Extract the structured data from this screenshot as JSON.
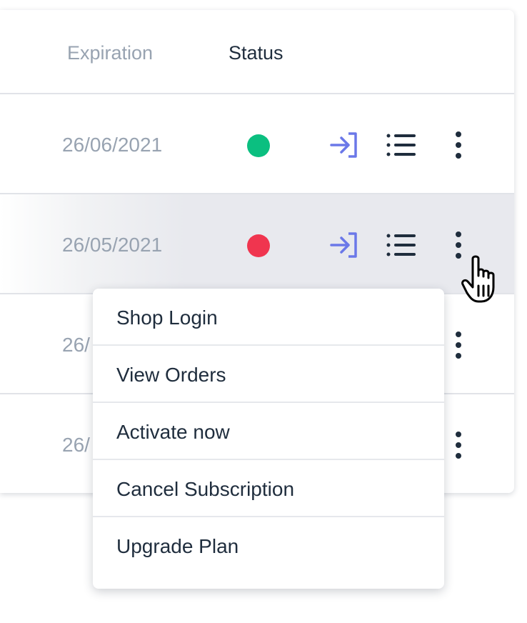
{
  "table": {
    "columns": {
      "expiration": "Expiration",
      "status": "Status"
    },
    "rows": [
      {
        "expiration": "26/06/2021",
        "status": "active",
        "status_color": "#0bbf80"
      },
      {
        "expiration": "26/05/2021",
        "status": "inactive",
        "status_color": "#f0354f",
        "hovered": true
      },
      {
        "expiration": "26/",
        "status": "",
        "status_color": ""
      },
      {
        "expiration": "26/",
        "status": "",
        "status_color": ""
      }
    ],
    "row_action_icons": [
      "login-icon",
      "list-icon",
      "more-vertical-icon"
    ]
  },
  "context_menu": {
    "items": [
      {
        "label": "Shop Login"
      },
      {
        "label": "View Orders"
      },
      {
        "label": "Activate now"
      },
      {
        "label": "Cancel Subscription"
      },
      {
        "label": "Upgrade Plan"
      }
    ]
  },
  "colors": {
    "accent": "#6b78e8",
    "text_primary": "#1f2d3d",
    "text_muted": "#98a3b1",
    "status_active": "#0bbf80",
    "status_inactive": "#f0354f",
    "hover_row_bg": "#e8e9ee"
  },
  "cursor": {
    "type": "hand-pointer-icon"
  }
}
